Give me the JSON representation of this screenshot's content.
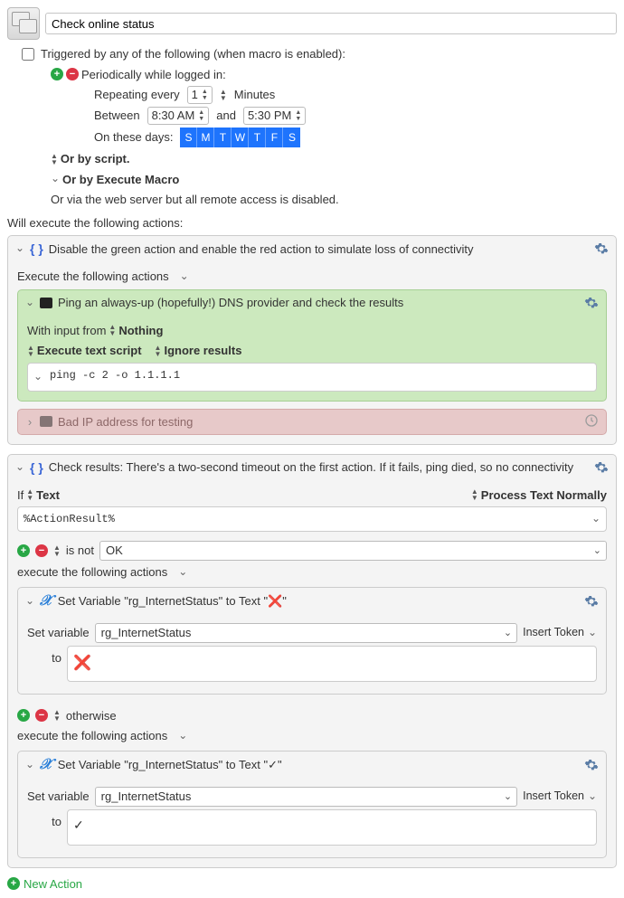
{
  "macro": {
    "title": "Check online status"
  },
  "triggers": {
    "header": "Triggered by any of the following (when macro is enabled):",
    "periodic_label": "Periodically while logged in:",
    "repeating_label": "Repeating every",
    "repeating_value": "1",
    "repeating_unit": "Minutes",
    "between_label": "Between",
    "between_start": "8:30 AM",
    "between_and": "and",
    "between_end": "5:30 PM",
    "days_label": "On these days:",
    "days": [
      "S",
      "M",
      "T",
      "W",
      "T",
      "F",
      "S"
    ],
    "or_script": "Or by script.",
    "or_execute": "Or by Execute Macro",
    "or_web": "Or via the web server but all remote access is disabled."
  },
  "exec_header": "Will execute the following actions:",
  "group1": {
    "title": "Disable the green action and enable the red action to simulate loss of connectivity",
    "subheader": "Execute the following actions",
    "green": {
      "title": "Ping an always-up (hopefully!) DNS provider and check the results",
      "with_input": "With input from",
      "with_input_val": "Nothing",
      "exec_script": "Execute text script",
      "ignore": "Ignore results",
      "script": "ping -c 2 -o 1.1.1.1"
    },
    "red": {
      "title": "Bad IP address for testing"
    }
  },
  "group2": {
    "title": "Check results: There's a two-second timeout on the first action. If it fails, ping died, so no connectivity",
    "if_label": "If",
    "if_type": "Text",
    "process": "Process Text Normally",
    "action_result": "%ActionResult%",
    "cond_op": "is not",
    "cond_val": "OK",
    "exec_label": "execute the following actions",
    "set1": {
      "title": "Set Variable \"rg_InternetStatus\" to Text \"❌\"",
      "setvar_label": "Set variable",
      "var": "rg_InternetStatus",
      "insert": "Insert Token",
      "to_label": "to",
      "to_value": "❌"
    },
    "otherwise": "otherwise",
    "set2": {
      "title": "Set Variable \"rg_InternetStatus\" to Text \"✓\"",
      "setvar_label": "Set variable",
      "var": "rg_InternetStatus",
      "insert": "Insert Token",
      "to_label": "to",
      "to_value": "✓"
    }
  },
  "footer": {
    "new_action": "New Action"
  }
}
